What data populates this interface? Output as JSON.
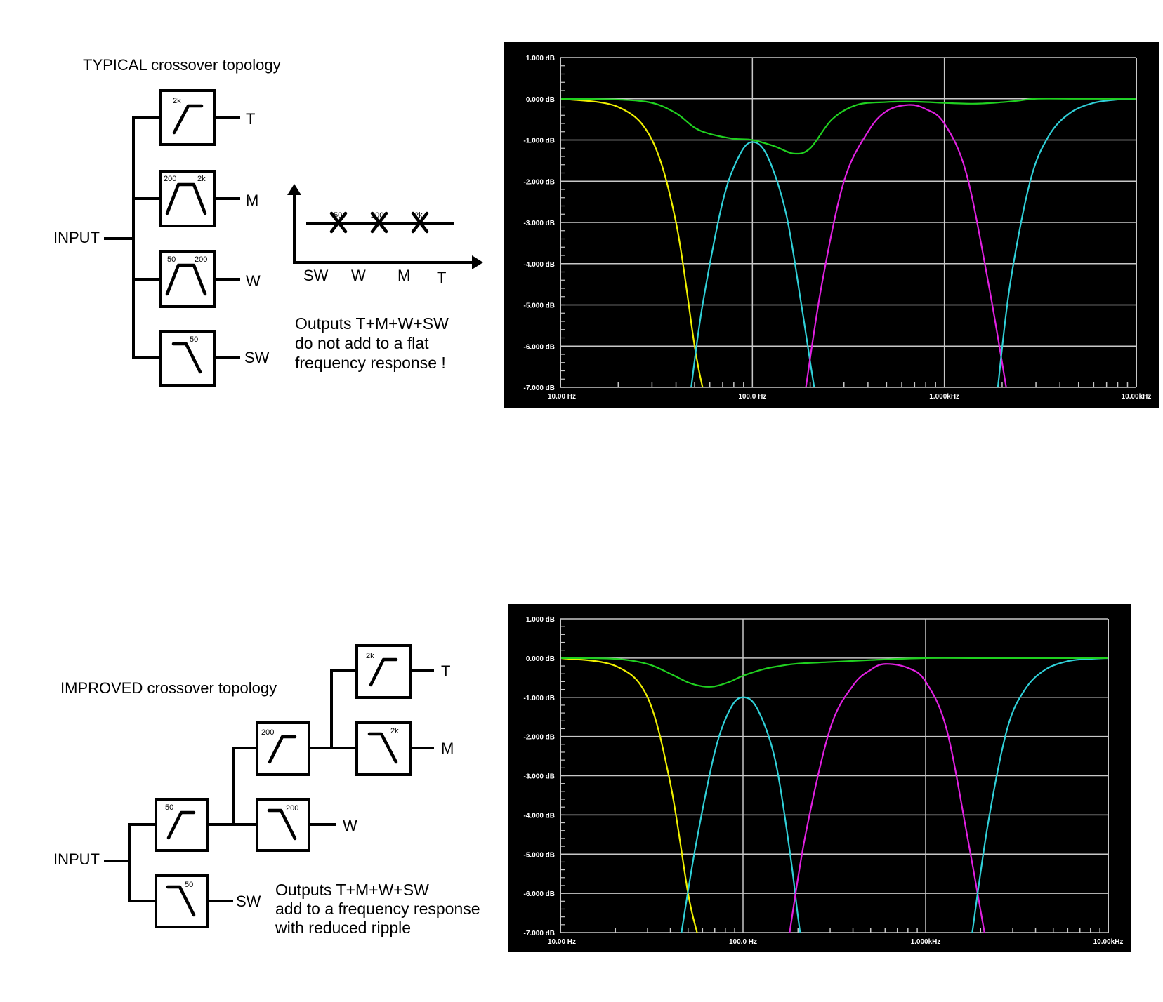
{
  "top": {
    "title": "TYPICAL crossover topology",
    "input_label": "INPUT",
    "filters": [
      {
        "output": "T",
        "marks": [
          "2k"
        ],
        "type": "highpass"
      },
      {
        "output": "M",
        "marks": [
          "200",
          "2k"
        ],
        "type": "bandpass"
      },
      {
        "output": "W",
        "marks": [
          "50",
          "200"
        ],
        "type": "bandpass"
      },
      {
        "output": "SW",
        "marks": [
          "50"
        ],
        "type": "lowpass"
      }
    ],
    "response_sketch": {
      "crossovers": [
        "50",
        "200",
        "2k"
      ],
      "bands": [
        "SW",
        "W",
        "M",
        "T"
      ]
    },
    "note": [
      "Outputs T+M+W+SW",
      "do not add to a flat",
      "frequency response !"
    ]
  },
  "bottom": {
    "title": "IMPROVED crossover topology",
    "input_label": "INPUT",
    "filters": [
      {
        "marks": [
          "2k"
        ],
        "type": "highpass",
        "output": "T"
      },
      {
        "marks": [
          "2k"
        ],
        "type": "lowpass",
        "output": "M"
      },
      {
        "marks": [
          "200"
        ],
        "type": "highpass",
        "output": ""
      },
      {
        "marks": [
          "200"
        ],
        "type": "lowpass",
        "output": "W"
      },
      {
        "marks": [
          "50"
        ],
        "type": "highpass",
        "output": ""
      },
      {
        "marks": [
          "50"
        ],
        "type": "lowpass",
        "output": "SW"
      }
    ],
    "note": [
      "Outputs T+M+W+SW",
      "add to a frequency response",
      "with reduced ripple"
    ]
  },
  "colors": {
    "plot_background": "#000000",
    "grid": "#c8c8c8",
    "sw": "#f0f000",
    "w": "#30d0d8",
    "m": "#e020e0",
    "t": "#30d0d8",
    "sum": "#20d020"
  },
  "chart_data": [
    {
      "type": "line",
      "x_scale": "log",
      "xlim": [
        10,
        10000
      ],
      "ylim": [
        -7,
        1
      ],
      "x_tick_labels": [
        "10.00 Hz",
        "100.0 Hz",
        "1.000kHz",
        "10.00kHz"
      ],
      "y_tick_labels": [
        "1.000 dB",
        "0.000 dB",
        "-1.000 dB",
        "-2.000 dB",
        "-3.000 dB",
        "-4.000 dB",
        "-5.000 dB",
        "-6.000 dB",
        "-7.000 dB"
      ],
      "grid": true,
      "series": [
        {
          "key": "sw",
          "x": [
            10,
            20,
            30,
            40,
            50,
            55
          ],
          "y": [
            0,
            -0.2,
            -1.0,
            -3.0,
            -6.0,
            -7.0
          ]
        },
        {
          "key": "w",
          "x": [
            48,
            55,
            70,
            85,
            100,
            120,
            150,
            180,
            210,
            220
          ],
          "y": [
            -7.0,
            -5.0,
            -2.5,
            -1.4,
            -1.05,
            -1.4,
            -2.8,
            -5.0,
            -7.0,
            -7.3
          ]
        },
        {
          "key": "m",
          "x": [
            190,
            230,
            300,
            400,
            500,
            650,
            800,
            1000,
            1300,
            1700,
            2100
          ],
          "y": [
            -7.0,
            -4.5,
            -2.0,
            -0.8,
            -0.3,
            -0.15,
            -0.25,
            -0.6,
            -1.8,
            -4.5,
            -7.0
          ]
        },
        {
          "key": "t",
          "x": [
            1900,
            2200,
            2800,
            3500,
            4500,
            6000,
            8000,
            10000
          ],
          "y": [
            -7.0,
            -4.5,
            -2.0,
            -0.9,
            -0.35,
            -0.1,
            -0.02,
            0
          ]
        },
        {
          "key": "sum",
          "x": [
            10,
            20,
            30,
            40,
            50,
            60,
            80,
            100,
            130,
            165,
            200,
            260,
            350,
            500,
            700,
            1000,
            1400,
            1800,
            2400,
            3000,
            5000,
            10000
          ],
          "y": [
            0,
            -0.02,
            -0.1,
            -0.35,
            -0.7,
            -0.85,
            -0.97,
            -1.0,
            -1.15,
            -1.33,
            -1.2,
            -0.5,
            -0.15,
            -0.08,
            -0.07,
            -0.1,
            -0.12,
            -0.1,
            -0.05,
            0,
            0,
            0
          ]
        }
      ]
    },
    {
      "type": "line",
      "x_scale": "log",
      "xlim": [
        10,
        10000
      ],
      "ylim": [
        -7,
        1
      ],
      "x_tick_labels": [
        "10.00 Hz",
        "100.0 Hz",
        "1.000kHz",
        "10.00kHz"
      ],
      "y_tick_labels": [
        "1.000 dB",
        "0.000 dB",
        "-1.000 dB",
        "-2.000 dB",
        "-3.000 dB",
        "-4.000 dB",
        "-5.000 dB",
        "-6.000 dB",
        "-7.000 dB"
      ],
      "grid": true,
      "series": [
        {
          "key": "sw",
          "x": [
            10,
            20,
            30,
            40,
            50,
            56
          ],
          "y": [
            0,
            -0.2,
            -1.0,
            -3.2,
            -6.0,
            -7.0
          ]
        },
        {
          "key": "w",
          "x": [
            46,
            55,
            70,
            85,
            100,
            120,
            150,
            180,
            200,
            210
          ],
          "y": [
            -7.0,
            -4.8,
            -2.4,
            -1.3,
            -1.0,
            -1.3,
            -2.6,
            -4.9,
            -6.6,
            -7.3
          ]
        },
        {
          "key": "m",
          "x": [
            180,
            220,
            300,
            400,
            500,
            600,
            800,
            1000,
            1300,
            1700,
            2100
          ],
          "y": [
            -7.0,
            -4.5,
            -1.8,
            -0.7,
            -0.3,
            -0.15,
            -0.25,
            -0.6,
            -1.8,
            -4.6,
            -7.0
          ]
        },
        {
          "key": "t",
          "x": [
            1800,
            2200,
            2800,
            3500,
            4500,
            6000,
            8000,
            10000
          ],
          "y": [
            -7.0,
            -4.2,
            -1.8,
            -0.8,
            -0.3,
            -0.08,
            -0.02,
            0
          ]
        },
        {
          "key": "sum",
          "x": [
            10,
            20,
            30,
            40,
            50,
            60,
            70,
            85,
            100,
            130,
            160,
            200,
            300,
            500,
            1000,
            2000,
            5000,
            10000
          ],
          "y": [
            0,
            -0.02,
            -0.15,
            -0.4,
            -0.62,
            -0.72,
            -0.72,
            -0.6,
            -0.45,
            -0.28,
            -0.2,
            -0.14,
            -0.1,
            -0.05,
            0,
            0,
            0,
            0
          ]
        }
      ]
    }
  ]
}
